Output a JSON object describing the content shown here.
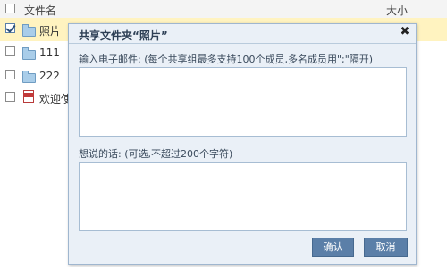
{
  "list": {
    "header": {
      "name_label": "文件名",
      "size_label": "大小"
    },
    "rows": [
      {
        "name": "照片",
        "type": "folder",
        "checked": true
      },
      {
        "name": "111",
        "type": "folder",
        "checked": false
      },
      {
        "name": "222",
        "type": "folder",
        "checked": false
      },
      {
        "name": "欢迎使",
        "type": "pdf",
        "checked": false
      }
    ]
  },
  "dialog": {
    "title": "共享文件夹“照片”",
    "close_glyph": "✖",
    "email_label": "输入电子邮件: (每个共享组最多支持100个成员,多名成员用\";\"隔开)",
    "email_value": "",
    "message_label": "想说的话: (可选,不超过200个字符)",
    "message_value": "",
    "confirm_label": "确认",
    "cancel_label": "取消"
  },
  "colors": {
    "selected_row": "#fff3c0",
    "dialog_bg": "#eaf0f7",
    "button_bg": "#5b7fa8"
  }
}
